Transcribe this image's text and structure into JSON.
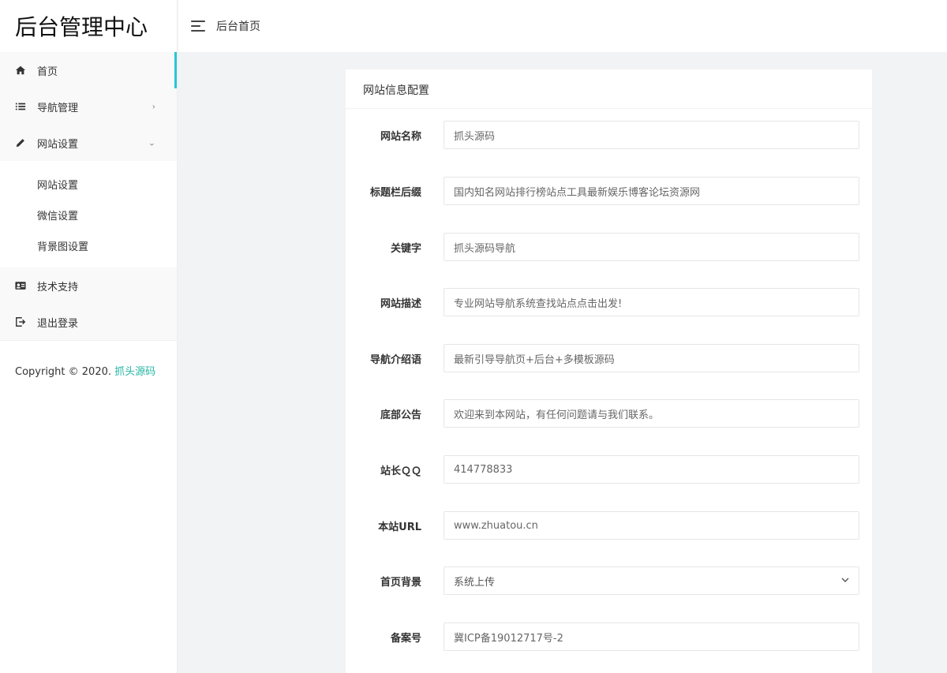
{
  "brand": "后台管理中心",
  "topbar": {
    "title": "后台首页"
  },
  "sidebar": {
    "items": [
      {
        "label": "首页",
        "icon": "home-icon"
      },
      {
        "label": "导航管理",
        "icon": "list-icon",
        "arrow": "›"
      },
      {
        "label": "网站设置",
        "icon": "pencil-icon",
        "arrow": "⌄"
      }
    ],
    "subitems": [
      "网站设置",
      "微信设置",
      "背景图设置"
    ],
    "bottom_items": [
      {
        "label": "技术支持",
        "icon": "id-card-icon"
      },
      {
        "label": "退出登录",
        "icon": "logout-icon"
      }
    ],
    "copyright_prefix": "Copyright © 2020.",
    "copyright_link": "抓头源码"
  },
  "card": {
    "title": "网站信息配置",
    "fields": [
      {
        "label": "网站名称",
        "value": "抓头源码"
      },
      {
        "label": "标题栏后缀",
        "value": "国内知名网站排行榜站点工具最新娱乐博客论坛资源网"
      },
      {
        "label": "关键字",
        "value": "抓头源码导航"
      },
      {
        "label": "网站描述",
        "value": "专业网站导航系统查找站点点击出发!"
      },
      {
        "label": "导航介绍语",
        "value": "最新引导导航页+后台+多模板源码"
      },
      {
        "label": "底部公告",
        "value": "欢迎来到本网站，有任何问题请与我们联系。"
      },
      {
        "label": "站长ＱＱ",
        "value": "414778833"
      },
      {
        "label": "本站URL",
        "value": "www.zhuatou.cn"
      },
      {
        "label": "首页背景",
        "value": "系统上传"
      },
      {
        "label": "备案号",
        "value": "冀ICP备19012717号-2"
      }
    ]
  }
}
